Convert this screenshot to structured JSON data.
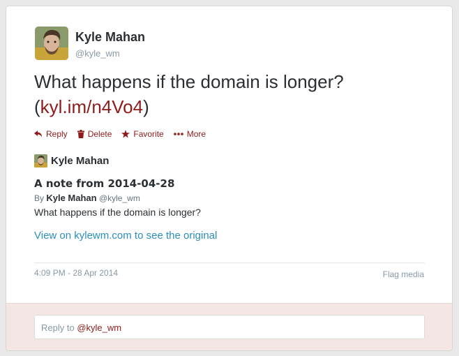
{
  "author": {
    "name": "Kyle Mahan",
    "handle": "@kyle_wm"
  },
  "tweet": {
    "text": "What happens if the domain is longer?",
    "link_open": "(",
    "link_text": "kyl.im/n4Vo4",
    "link_close": ")"
  },
  "actions": [
    {
      "label": "Reply",
      "icon": "reply-icon"
    },
    {
      "label": "Delete",
      "icon": "trash-icon"
    },
    {
      "label": "Favorite",
      "icon": "star-icon"
    },
    {
      "label": "More",
      "icon": "more-icon"
    }
  ],
  "embed": {
    "author_name": "Kyle Mahan",
    "title": "A note from 2014-04-28",
    "by_prefix": "By",
    "by_name": "Kyle Mahan",
    "by_handle": "@kyle_wm",
    "body": "What happens if the domain is longer?",
    "link_text": "View on kylewm.com to see the original"
  },
  "footer": {
    "timestamp": "4:09 PM - 28 Apr 2014",
    "flag": "Flag media"
  },
  "reply": {
    "prefix": "Reply to ",
    "mention": "@kyle_wm"
  },
  "colors": {
    "accent": "#8e1b1b",
    "link": "#2b8ebd",
    "reply_bg": "#f5e6e6"
  }
}
